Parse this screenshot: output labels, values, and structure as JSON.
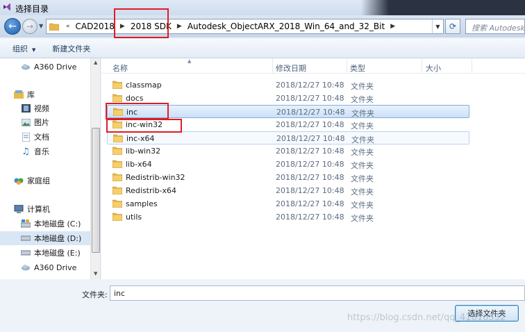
{
  "window": {
    "title": "选择目录"
  },
  "address": {
    "overflow_marker": "«",
    "crumbs": [
      "CAD2018",
      "2018 SDK",
      "Autodesk_ObjectARX_2018_Win_64_and_32_Bit"
    ]
  },
  "search": {
    "placeholder": "搜索 Autodesk..."
  },
  "toolbar": {
    "organize_label": "组织",
    "new_folder_label": "新建文件夹"
  },
  "nav": {
    "items": [
      {
        "label": "A360 Drive",
        "icon": "cloud-icon"
      },
      {
        "label": "库",
        "icon": "library-icon"
      },
      {
        "label": "视频",
        "icon": "video-icon"
      },
      {
        "label": "图片",
        "icon": "picture-icon"
      },
      {
        "label": "文档",
        "icon": "document-icon"
      },
      {
        "label": "音乐",
        "icon": "music-icon"
      },
      {
        "label": "家庭组",
        "icon": "homegroup-icon"
      },
      {
        "label": "计算机",
        "icon": "computer-icon"
      },
      {
        "label": "本地磁盘 (C:)",
        "icon": "drive-icon"
      },
      {
        "label": "本地磁盘 (D:)",
        "icon": "drive-icon",
        "selected": true
      },
      {
        "label": "本地磁盘 (E:)",
        "icon": "drive-icon"
      },
      {
        "label": "A360 Drive",
        "icon": "cloud-icon"
      }
    ]
  },
  "columns": {
    "name": "名称",
    "date": "修改日期",
    "type": "类型",
    "size": "大小"
  },
  "files": [
    {
      "name": "classmap",
      "date": "2018/12/27 10:48",
      "type": "文件夹"
    },
    {
      "name": "docs",
      "date": "2018/12/27 10:48",
      "type": "文件夹"
    },
    {
      "name": "inc",
      "date": "2018/12/27 10:48",
      "type": "文件夹",
      "selected": true
    },
    {
      "name": "inc-win32",
      "date": "2018/12/27 10:48",
      "type": "文件夹"
    },
    {
      "name": "inc-x64",
      "date": "2018/12/27 10:48",
      "type": "文件夹",
      "hover": true
    },
    {
      "name": "lib-win32",
      "date": "2018/12/27 10:48",
      "type": "文件夹"
    },
    {
      "name": "lib-x64",
      "date": "2018/12/27 10:48",
      "type": "文件夹"
    },
    {
      "name": "Redistrib-win32",
      "date": "2018/12/27 10:48",
      "type": "文件夹"
    },
    {
      "name": "Redistrib-x64",
      "date": "2018/12/27 10:48",
      "type": "文件夹"
    },
    {
      "name": "samples",
      "date": "2018/12/27 10:48",
      "type": "文件夹"
    },
    {
      "name": "utils",
      "date": "2018/12/27 10:48",
      "type": "文件夹"
    }
  ],
  "folder_field": {
    "label": "文件夹:",
    "value": "inc"
  },
  "buttons": {
    "select_folder": "选择文件夹"
  },
  "watermark": "https://blog.csdn.net/qq_41016532",
  "colors": {
    "highlight_box": "#e01c24",
    "selection": "#cde1f7",
    "folder": "#e8b84a"
  }
}
